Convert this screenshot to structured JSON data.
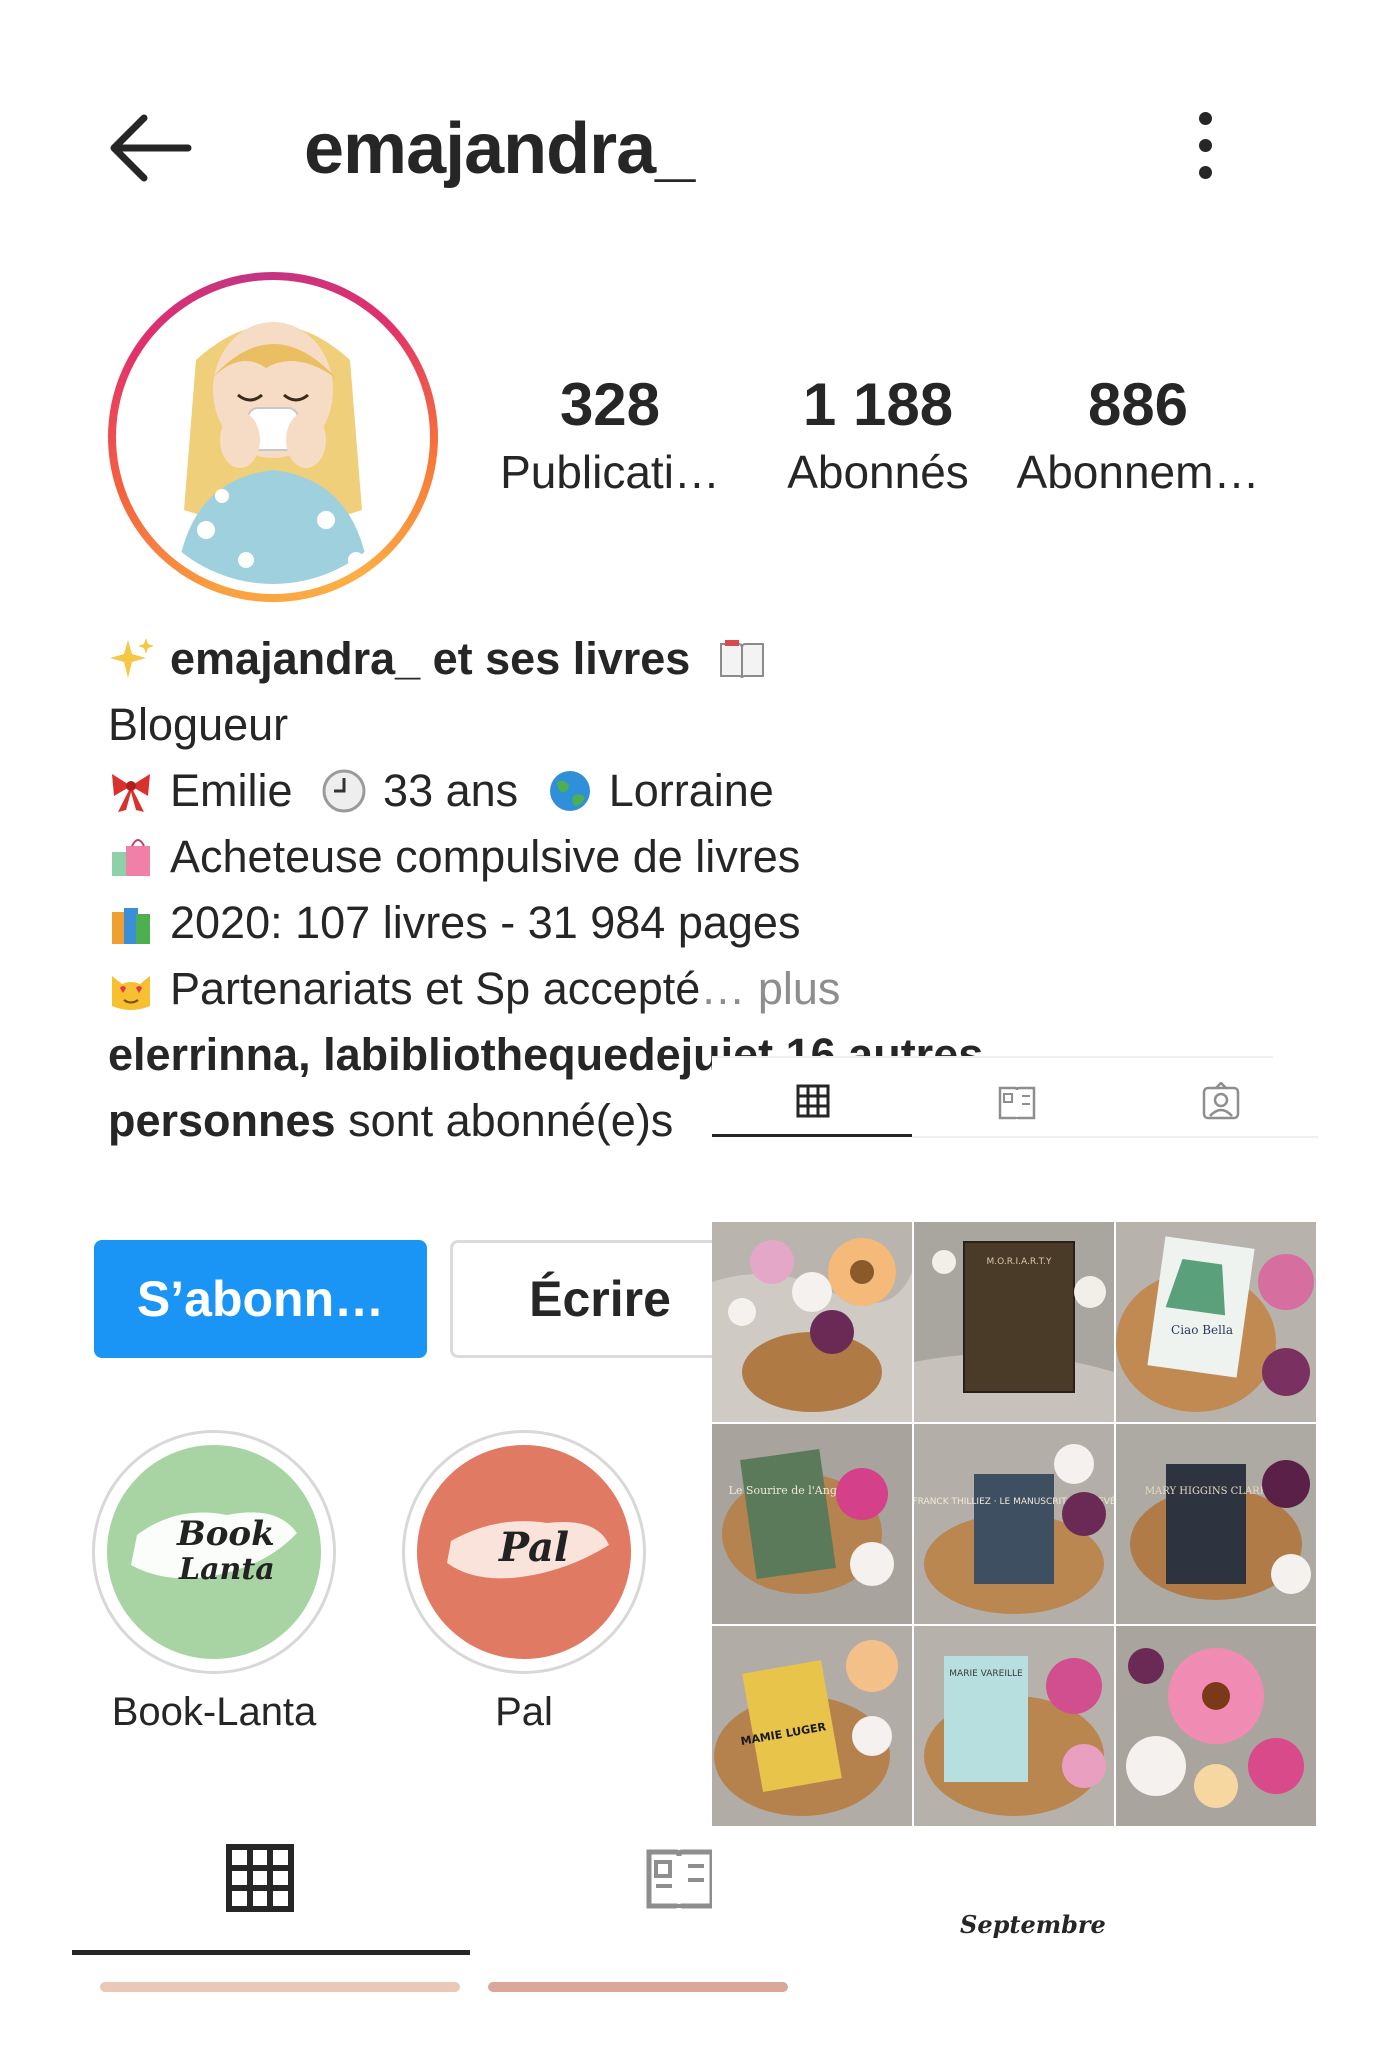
{
  "header": {
    "username": "emajandra_",
    "back_icon": "back-arrow-icon",
    "more_icon": "more-vertical-icon"
  },
  "stats": [
    {
      "number": "328",
      "label": "Publicati…"
    },
    {
      "number": "1 188",
      "label": "Abonnés"
    },
    {
      "number": "886",
      "label": "Abonnem…"
    }
  ],
  "bio": {
    "name": "emajandra_ et ses livres",
    "category": "Blogueur",
    "line1": "Emilie",
    "line1_age": "33 ans",
    "line1_place": "Lorraine",
    "line2": "Acheteuse compulsive de livres",
    "line3": "2020: 107 livres - 31 984 pages",
    "line4": "Partenariats et Sp accepté",
    "more": "… plus",
    "followed_by_bold": "elerrinna, labibliothequedejui",
    "followed_by_bold_cut": "et 16 autres",
    "followed_by_bold2": "personnes",
    "followed_by_rest": " sont abonné(e)s"
  },
  "buttons": {
    "follow": "S’abonn…",
    "message": "Écrire"
  },
  "highlights": [
    {
      "label": "Book-Lanta",
      "cover_text_1": "Book",
      "cover_text_2": "Lanta",
      "color": "#a8d4a4"
    },
    {
      "label": "Pal",
      "cover_text_1": "Pal",
      "color": "#e07a63"
    }
  ],
  "tabs": {
    "grid_icon": "grid-icon",
    "guides_icon": "guides-icon",
    "tagged_icon": "tagged-icon"
  },
  "grid_panel": {
    "caption": "Septembre",
    "posts": [
      {
        "book_title": ""
      },
      {
        "book_title": "M.O.R.I.A.R.T.Y"
      },
      {
        "book_title": "Ciao Bella"
      },
      {
        "book_title": "Le Sourire de l'Ange"
      },
      {
        "book_title": "FRANCK THILLIEZ · LE MANUSCRIT INACHEVÉ"
      },
      {
        "book_title": "MARY HIGGINS CLARK"
      },
      {
        "book_title": "MAMIE LUGER"
      },
      {
        "book_title": "MARIE VAREILLE"
      },
      {
        "book_title": ""
      }
    ]
  },
  "colors": {
    "accent": "#1a95f5",
    "text": "#262626",
    "muted": "#8e8e8e"
  }
}
